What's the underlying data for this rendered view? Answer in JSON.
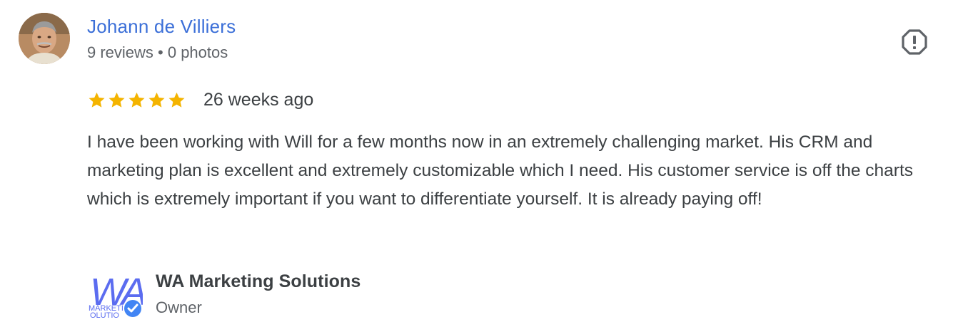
{
  "reviewer": {
    "name": "Johann de Villiers",
    "meta": "9 reviews • 0 photos",
    "avatar_icon": "user-photo"
  },
  "review": {
    "rating": 5,
    "rating_max": 5,
    "date": "26 weeks ago",
    "text": "I have been working with Will for a few months now in an extremely challenging market. His CRM and marketing plan is excellent and extremely customizable which I need. His customer service is off the charts which is extremely important if you want to differentiate yourself. It is already paying off!"
  },
  "actions": {
    "report_icon": "report-icon"
  },
  "owner_response": {
    "name": "WA Marketing Solutions",
    "role": "Owner",
    "logo_text": "WA",
    "logo_subtext": "MARKETING SOLUTIONS",
    "verified_icon": "verified-badge-icon"
  },
  "colors": {
    "link_blue": "#3b6fd8",
    "star_gold": "#f4b400",
    "text_primary": "#3c4043",
    "text_secondary": "#5f6368",
    "logo_blue": "#5b6cf0",
    "verified_blue": "#4285f4"
  }
}
